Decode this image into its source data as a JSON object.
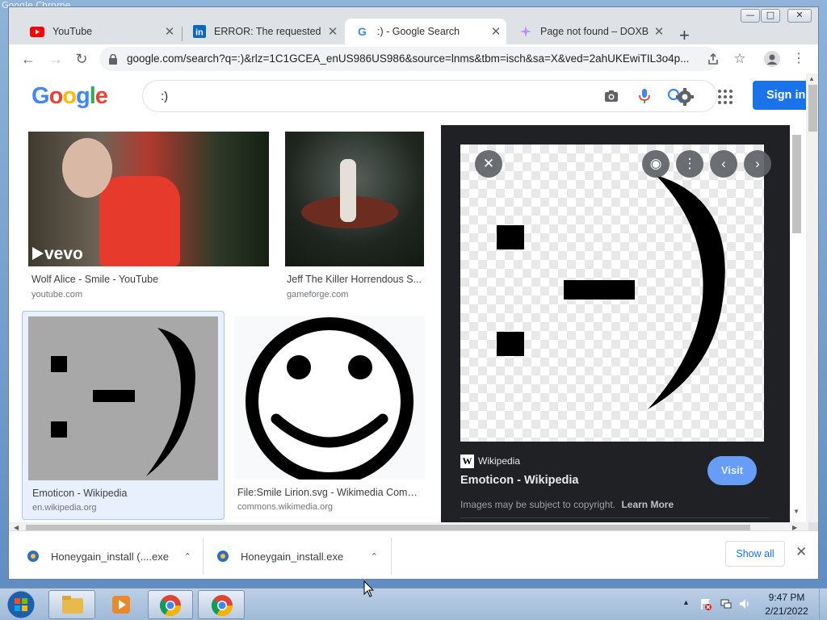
{
  "window": {
    "title": "Google Chrome"
  },
  "tabs": [
    {
      "label": "YouTube",
      "active": false
    },
    {
      "label": "ERROR: The requested URL",
      "active": false
    },
    {
      "label": ":) - Google Search",
      "active": true
    },
    {
      "label": "Page not found – DOXBOX",
      "active": false
    }
  ],
  "toolbar": {
    "url": "google.com/search?q=:)&rlz=1C1GCEA_enUS986US986&source=lnms&tbm=isch&sa=X&ved=2ahUKEwiTIL3o4p..."
  },
  "google": {
    "logo": "Google",
    "query": ":)",
    "sign_in": "Sign in"
  },
  "results": [
    {
      "caption": "Wolf Alice - Smile - YouTube",
      "source": "youtube.com",
      "overlay": "vevo"
    },
    {
      "caption": "Jeff The Killer Horrendous S...",
      "source": "gameforge.com"
    },
    {
      "caption": "Emoticon - Wikipedia",
      "source": "en.wikipedia.org",
      "thumb_text": ":-)"
    },
    {
      "caption": "File:Smile Lirion.svg - Wikimedia Comm...",
      "source": "commons.wikimedia.org"
    }
  ],
  "preview": {
    "image_text": ":-)",
    "site_icon": "W",
    "site": "Wikipedia",
    "title": "Emoticon - Wikipedia",
    "visit": "Visit",
    "copyright": "Images may be subject to copyright.",
    "learn_more": "Learn More"
  },
  "downloads": {
    "items": [
      {
        "name": "Honeygain_install (....exe"
      },
      {
        "name": "Honeygain_install.exe"
      }
    ],
    "show_all": "Show all"
  },
  "taskbar": {
    "time": "9:47 PM",
    "date": "2/21/2022"
  }
}
